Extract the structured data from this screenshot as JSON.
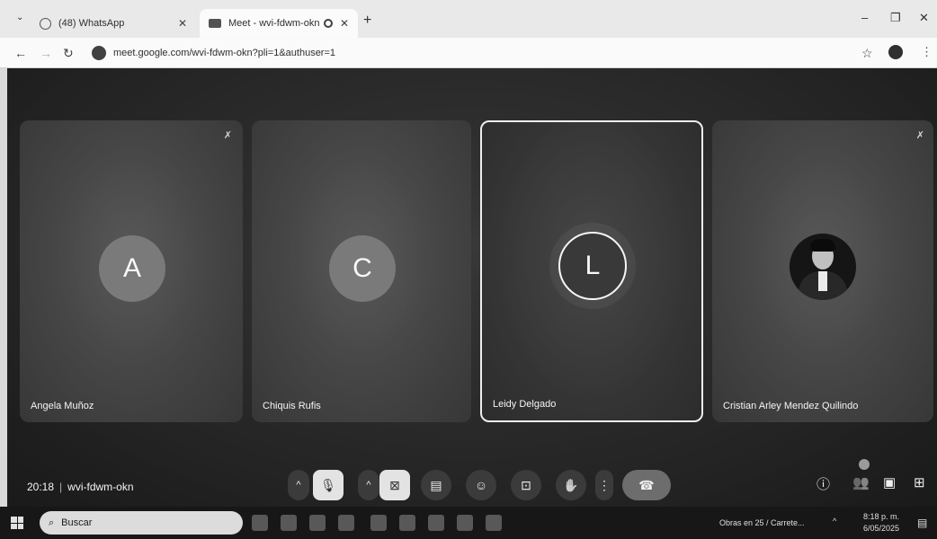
{
  "browser": {
    "tabs": [
      {
        "title": "(48) WhatsApp",
        "active": false
      },
      {
        "title": "Meet - wvi-fdwm-okn",
        "active": true
      }
    ],
    "new_tab": "+",
    "url": "meet.google.com/wvi-fdwm-okn?pli=1&authuser=1",
    "window_controls": {
      "minimize": "–",
      "restore": "❐",
      "close": "✕"
    }
  },
  "meet": {
    "time": "20:18",
    "separator": "|",
    "meeting_code": "wvi-fdwm-okn",
    "participants": [
      {
        "name": "Angela Muñoz",
        "initial": "A",
        "muted": true,
        "speaking": false,
        "avatar_type": "initial"
      },
      {
        "name": "Chiquis Rufis",
        "initial": "C",
        "muted": false,
        "speaking": false,
        "avatar_type": "initial"
      },
      {
        "name": "Leidy Delgado",
        "initial": "L",
        "muted": false,
        "speaking": true,
        "avatar_type": "ring"
      },
      {
        "name": "Cristian Arley Mendez Quilindo",
        "initial": "",
        "muted": true,
        "speaking": false,
        "avatar_type": "photo"
      }
    ]
  },
  "taskbar": {
    "search_placeholder": "Buscar",
    "weather": "Obras en 25 / Carrete...",
    "clock_time": "8:18 p. m.",
    "clock_date": "6/05/2025"
  },
  "icons": {
    "mic": "mic-off-icon",
    "camera": "camera-off-icon",
    "captions": "captions-icon",
    "emoji": "emoji-icon",
    "present": "present-icon",
    "hand": "raise-hand-icon",
    "more": "more-options-icon",
    "end": "end-call-icon"
  }
}
